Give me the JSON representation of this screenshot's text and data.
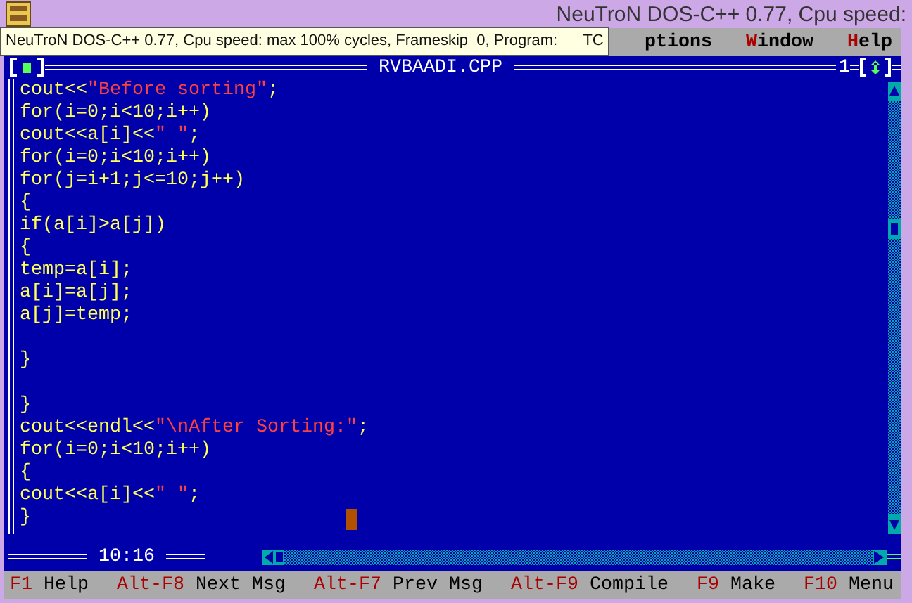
{
  "window": {
    "title": "NeuTroN DOS-C++ 0.77, Cpu speed:"
  },
  "tooltip": {
    "text": "NeuTroN DOS-C++ 0.77, Cpu speed: max 100% cycles, Frameskip  0, Program:      TC"
  },
  "menu": [
    {
      "rest": "ptions"
    },
    {
      "hotkey": "W",
      "rest": "indow"
    },
    {
      "hotkey": "H",
      "rest": "elp"
    }
  ],
  "editor": {
    "title": "RVBAADI.CPP",
    "window_number": "1",
    "position": "10:16",
    "lines": [
      {
        "kind": "code",
        "segments": [
          {
            "kind": "code",
            "text": "cout<<"
          },
          {
            "kind": "string",
            "text": "\"Before sorting\""
          },
          {
            "kind": "code",
            "text": ";"
          }
        ]
      },
      {
        "kind": "code",
        "segments": [
          {
            "kind": "code",
            "text": "for(i=0;i<10;i++)"
          }
        ]
      },
      {
        "kind": "code",
        "segments": [
          {
            "kind": "code",
            "text": "cout<<a[i]<<"
          },
          {
            "kind": "string",
            "text": "\" \""
          },
          {
            "kind": "code",
            "text": ";"
          }
        ]
      },
      {
        "kind": "code",
        "segments": [
          {
            "kind": "code",
            "text": "for(i=0;i<10;i++)"
          }
        ]
      },
      {
        "kind": "code",
        "segments": [
          {
            "kind": "code",
            "text": "for(j=i+1;j<=10;j++)"
          }
        ]
      },
      {
        "kind": "code",
        "segments": [
          {
            "kind": "code",
            "text": "{"
          }
        ]
      },
      {
        "kind": "code",
        "segments": [
          {
            "kind": "code",
            "text": "if(a[i]>a[j])"
          }
        ]
      },
      {
        "kind": "code",
        "segments": [
          {
            "kind": "code",
            "text": "{"
          }
        ]
      },
      {
        "kind": "code",
        "segments": [
          {
            "kind": "code",
            "text": "temp=a[i];"
          }
        ]
      },
      {
        "kind": "code",
        "segments": [
          {
            "kind": "code",
            "text": "a[i]=a[j];"
          }
        ]
      },
      {
        "kind": "code",
        "segments": [
          {
            "kind": "code",
            "text": "a[j]=temp;"
          }
        ]
      },
      {
        "kind": "blank"
      },
      {
        "kind": "code",
        "segments": [
          {
            "kind": "code",
            "text": "}"
          }
        ]
      },
      {
        "kind": "blank"
      },
      {
        "kind": "code",
        "segments": [
          {
            "kind": "code",
            "text": "}"
          }
        ]
      },
      {
        "kind": "code",
        "segments": [
          {
            "kind": "code",
            "text": "cout<<endl<<"
          },
          {
            "kind": "string",
            "text": "\"\\nAfter Sorting:\""
          },
          {
            "kind": "code",
            "text": ";"
          }
        ]
      },
      {
        "kind": "code",
        "segments": [
          {
            "kind": "code",
            "text": "for(i=0;i<10;i++)"
          }
        ]
      },
      {
        "kind": "code",
        "segments": [
          {
            "kind": "code",
            "text": "{"
          }
        ]
      },
      {
        "kind": "code",
        "segments": [
          {
            "kind": "code",
            "text": "cout<<a[i]<<"
          },
          {
            "kind": "string",
            "text": "\" \""
          },
          {
            "kind": "code",
            "text": ";"
          }
        ]
      },
      {
        "kind": "code",
        "cursor": true,
        "segments": [
          {
            "kind": "code",
            "text": "}"
          }
        ]
      }
    ]
  },
  "status_bar": [
    {
      "key": "F1",
      "label": "Help"
    },
    {
      "key": "Alt-F8",
      "label": "Next Msg"
    },
    {
      "key": "Alt-F7",
      "label": "Prev Msg"
    },
    {
      "key": "Alt-F9",
      "label": "Compile"
    },
    {
      "key": "F9",
      "label": "Make"
    },
    {
      "key": "F10",
      "label": "Menu"
    }
  ]
}
